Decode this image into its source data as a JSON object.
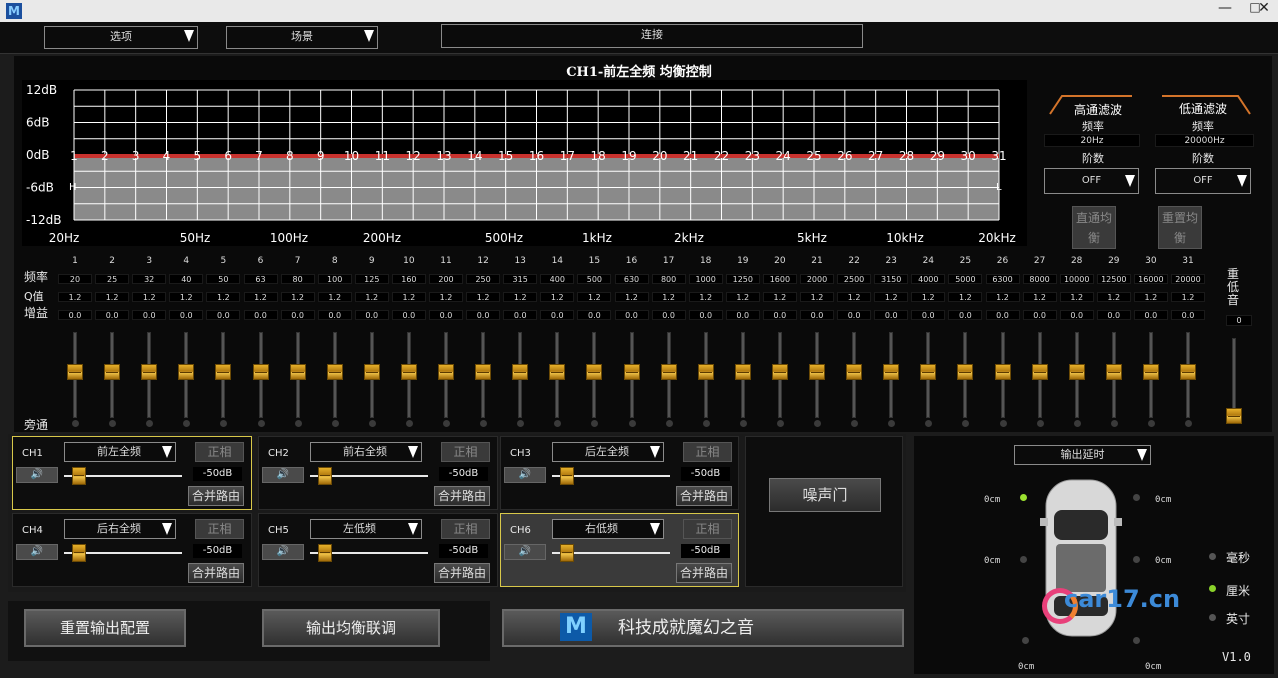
{
  "window": {
    "icon_letter": "M",
    "min": "—",
    "max": "□",
    "close": "✕"
  },
  "topbar": {
    "options_label": "选项",
    "scene_label": "场景",
    "connect_label": "连接"
  },
  "eq_title": "CH1-前左全频 均衡控制",
  "graph": {
    "y_labels": [
      "12dB",
      "6dB",
      "0dB",
      "-6dB",
      "-12dB"
    ],
    "x_labels": [
      "20Hz",
      "50Hz",
      "100Hz",
      "200Hz",
      "500Hz",
      "1kHz",
      "2kHz",
      "5kHz",
      "10kHz",
      "20kHz"
    ],
    "band_numbers": [
      "1",
      "2",
      "3",
      "4",
      "5",
      "6",
      "7",
      "8",
      "9",
      "10",
      "11",
      "12",
      "13",
      "14",
      "15",
      "16",
      "17",
      "18",
      "19",
      "20",
      "21",
      "22",
      "23",
      "24",
      "25",
      "26",
      "27",
      "28",
      "29",
      "30",
      "31"
    ],
    "marker_h": "H",
    "marker_l": "L",
    "curve_color": "#c8322e"
  },
  "filters": {
    "hp": {
      "title": "高通滤波",
      "freq_label": "频率",
      "freq": "20Hz",
      "order_label": "阶数",
      "order": "OFF"
    },
    "lp": {
      "title": "低通滤波",
      "freq_label": "频率",
      "freq": "20000Hz",
      "order_label": "阶数",
      "order": "OFF"
    },
    "bypass_label": "直通均衡",
    "reset_label": "重置均衡"
  },
  "bands": {
    "row_labels": {
      "freq": "频率",
      "q": "Q值",
      "gain": "增益",
      "bypass": "旁通"
    },
    "numbers": [
      "1",
      "2",
      "3",
      "4",
      "5",
      "6",
      "7",
      "8",
      "9",
      "10",
      "11",
      "12",
      "13",
      "14",
      "15",
      "16",
      "17",
      "18",
      "19",
      "20",
      "21",
      "22",
      "23",
      "24",
      "25",
      "26",
      "27",
      "28",
      "29",
      "30",
      "31"
    ],
    "freqs": [
      "20",
      "25",
      "32",
      "40",
      "50",
      "63",
      "80",
      "100",
      "125",
      "160",
      "200",
      "250",
      "315",
      "400",
      "500",
      "630",
      "800",
      "1000",
      "1250",
      "1600",
      "2000",
      "2500",
      "3150",
      "4000",
      "5000",
      "6300",
      "8000",
      "10000",
      "12500",
      "16000",
      "20000"
    ],
    "q": "1.2",
    "gain": "0.0"
  },
  "subwoofer": {
    "label_1": "重",
    "label_2": "低",
    "label_3": "音",
    "value": "0"
  },
  "channels": [
    {
      "id": "CH1",
      "name": "前左全频",
      "phase": "正相",
      "db": "-50dB",
      "merge": "合并路由"
    },
    {
      "id": "CH2",
      "name": "前右全频",
      "phase": "正相",
      "db": "-50dB",
      "merge": "合并路由"
    },
    {
      "id": "CH3",
      "name": "后左全频",
      "phase": "正相",
      "db": "-50dB",
      "merge": "合并路由"
    },
    {
      "id": "CH4",
      "name": "后右全频",
      "phase": "正相",
      "db": "-50dB",
      "merge": "合并路由"
    },
    {
      "id": "CH5",
      "name": "左低频",
      "phase": "正相",
      "db": "-50dB",
      "merge": "合并路由"
    },
    {
      "id": "CH6",
      "name": "右低频",
      "phase": "正相",
      "db": "-50dB",
      "merge": "合并路由"
    }
  ],
  "speaker_icon": "🔊",
  "noise_gate_label": "噪声门",
  "bottom": {
    "reset_output": "重置输出配置",
    "link_eq": "输出均衡联调",
    "brand_text": "科技成就魔幻之音",
    "logo_letter": "M"
  },
  "delay": {
    "dropdown": "输出延时",
    "values": [
      "0cm",
      "0cm",
      "0cm",
      "0cm",
      "0cm",
      "0cm"
    ],
    "units": [
      "毫秒",
      "厘米",
      "英寸"
    ],
    "version": "V1.0"
  },
  "watermark": "car17.cn"
}
